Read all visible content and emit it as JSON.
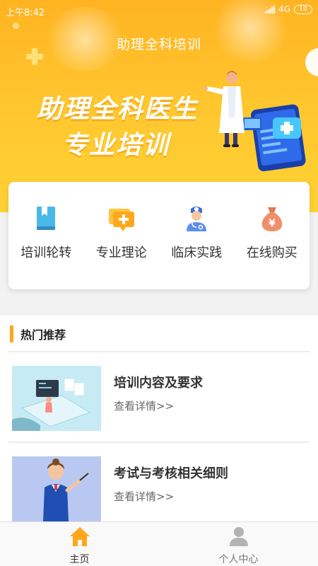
{
  "status_bar": {
    "time": "上午8:42",
    "network": "4G",
    "battery": "10"
  },
  "header": {
    "title": "助理全科培训",
    "slogan_line1": "助理全科医生",
    "slogan_line2": "专业培训"
  },
  "menu": [
    {
      "label": "培训轮转",
      "icon": "book-icon",
      "color": "#4ab8e8"
    },
    {
      "label": "专业理论",
      "icon": "chat-plus-icon",
      "color": "#ffa71c"
    },
    {
      "label": "临床实践",
      "icon": "doctor-icon",
      "color": "#5b8ef0"
    },
    {
      "label": "在线购买",
      "icon": "money-bag-icon",
      "color": "#f0906a"
    }
  ],
  "section": {
    "title": "热门推荐"
  },
  "articles": [
    {
      "title": "培训内容及要求",
      "link": "查看详情>>"
    },
    {
      "title": "考试与考核相关细则",
      "link": "查看详情>>"
    }
  ],
  "bottom_nav": [
    {
      "label": "主页",
      "icon": "home-icon",
      "active": true
    },
    {
      "label": "个人中心",
      "icon": "person-icon",
      "active": false
    }
  ],
  "colors": {
    "accent": "#ffa71c",
    "banner": "#ffc52e"
  }
}
